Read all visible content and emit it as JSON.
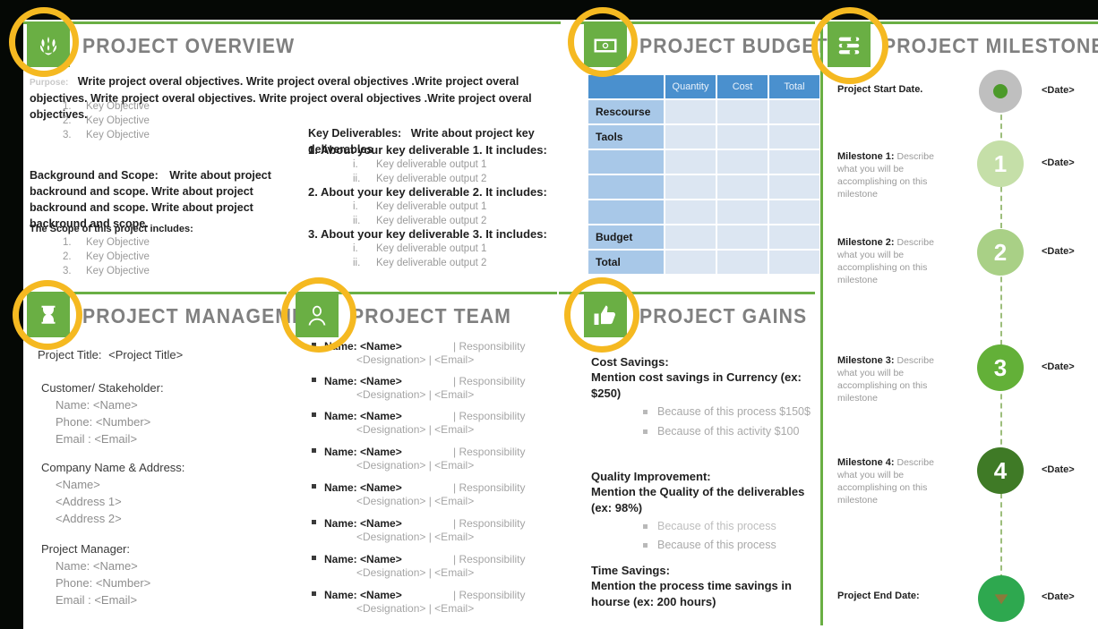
{
  "sections": {
    "overview": {
      "title": "PROJECT OVERVIEW",
      "icon": "laurel-wreath-icon",
      "purpose_label": "Purpose:",
      "purpose_text": "Write project overal objectives. Write project overal objectives .Write project overal objectives. Write project overal objectives. Write project overal objectives .Write project overal objectives.",
      "objectives": [
        "Key Objective",
        "Key Objective",
        "Key Objective"
      ],
      "background_label": "Background and Scope:",
      "background_text": "Write about project backround and scope. Write about project backround and scope. Write about project backround and scope.",
      "scope_label": "The Scope of this project includes:",
      "scope_items": [
        "Key Objective",
        "Key Objective",
        "Key Objective"
      ],
      "deliverables_label": "Key Deliverables:",
      "deliverables_text": "Write about project key deliverables",
      "deliverables": [
        {
          "heading": "1. About your key deliverable 1. It includes:",
          "outputs": [
            "Key deliverable output 1",
            "Key deliverable output 2"
          ]
        },
        {
          "heading": "2. About your key deliverable 2. It includes:",
          "outputs": [
            "Key deliverable output 1",
            "Key deliverable output 2"
          ]
        },
        {
          "heading": "3. About your key deliverable 3. It includes:",
          "outputs": [
            "Key deliverable output 1",
            "Key deliverable output 2"
          ]
        }
      ]
    },
    "budget": {
      "title": "PROJECT BUDGET",
      "icon": "money-bill-icon",
      "columns": [
        "",
        "Quantity",
        "Cost",
        "Total"
      ],
      "rows": [
        {
          "label": "Rescourse",
          "cells": [
            "",
            "",
            ""
          ]
        },
        {
          "label": "Taols",
          "cells": [
            "",
            "",
            ""
          ]
        },
        {
          "label": "",
          "cells": [
            "",
            "",
            ""
          ]
        },
        {
          "label": "",
          "cells": [
            "",
            "",
            ""
          ]
        },
        {
          "label": "",
          "cells": [
            "",
            "",
            ""
          ]
        },
        {
          "label": "Budget",
          "cells": [
            "",
            "",
            ""
          ]
        },
        {
          "label": "Total",
          "cells": [
            "",
            "",
            ""
          ]
        }
      ]
    },
    "milestones": {
      "title": "PROJECT MILESTONES",
      "icon": "sliders-icon",
      "items": [
        {
          "label": "Project Start Date.",
          "desc": "",
          "badge": "",
          "date": "<Date>",
          "color": "#BFBFBF",
          "dot": "#4C9A2A"
        },
        {
          "label": "Milestone 1:",
          "desc": " Describe what you will be accomplishing on this milestone",
          "badge": "1",
          "date": "<Date>",
          "color": "#C5DFA8",
          "dot": ""
        },
        {
          "label": "Milestone 2:",
          "desc": " Describe what you will be accomplishing on this milestone",
          "badge": "2",
          "date": "<Date>",
          "color": "#A9D086",
          "dot": ""
        },
        {
          "label": "Milestone 3:",
          "desc": " Describe what you will be accomplishing on this milestone",
          "badge": "3",
          "date": "<Date>",
          "color": "#63B038",
          "dot": ""
        },
        {
          "label": "Milestone 4:",
          "desc": " Describe what you will be accomplishing on this milestone",
          "badge": "4",
          "date": "<Date>",
          "color": "#3F7A26",
          "dot": ""
        },
        {
          "label": "Project End   Date:",
          "desc": "",
          "badge": "",
          "date": "<Date>",
          "color": "#2EA84F",
          "dot": "arrow-down-icon"
        }
      ]
    },
    "management": {
      "title": "PROJECT MANAGEMENT",
      "icon": "hourglass-icon",
      "project_title_label": "Project Title:",
      "project_title_value": "<Project Title>",
      "groups": [
        {
          "heading": "Customer/ Stakeholder:",
          "lines": [
            "Name: <Name>",
            "Phone: <Number>",
            "Email : <Email>"
          ]
        },
        {
          "heading": "Company Name &  Address:",
          "lines": [
            "<Name>",
            "<Address 1>",
            "<Address 2>"
          ]
        },
        {
          "heading": "Project Manager:",
          "lines": [
            "Name: <Name>",
            "Phone: <Number>",
            "Email : <Email>"
          ]
        }
      ]
    },
    "team": {
      "title": "PROJECT TEAM",
      "icon": "person-portrait-icon",
      "members": [
        {
          "name": "Name: <Name>",
          "responsibility": "| Responsibility",
          "detail": "<Designation> | <Email>"
        },
        {
          "name": "Name: <Name>",
          "responsibility": "| Responsibility",
          "detail": "<Designation> | <Email>"
        },
        {
          "name": "Name: <Name>",
          "responsibility": "| Responsibility",
          "detail": "<Designation> | <Email>"
        },
        {
          "name": "Name: <Name>",
          "responsibility": "| Responsibility",
          "detail": "<Designation> | <Email>"
        },
        {
          "name": "Name: <Name>",
          "responsibility": "| Responsibility",
          "detail": "<Designation> | <Email>"
        },
        {
          "name": "Name: <Name>",
          "responsibility": "| Responsibility",
          "detail": "<Designation> | <Email>"
        },
        {
          "name": "Name: <Name>",
          "responsibility": "| Responsibility",
          "detail": "<Designation> | <Email>"
        },
        {
          "name": "Name: <Name>",
          "responsibility": "| Responsibility",
          "detail": "<Designation> | <Email>"
        }
      ]
    },
    "gains": {
      "title": "PROJECT GAINS",
      "icon": "thumbs-up-icon",
      "groups": [
        {
          "heading": "Cost Savings:",
          "body": "Mention cost savings in Currency (ex: $250)",
          "bullets": [
            "Because of this process $150$",
            "Because of this activity  $100"
          ]
        },
        {
          "heading": "Quality Improvement:",
          "body": "Mention the Quality of the deliverables (ex: 98%)",
          "bullets": [
            "Because of this process",
            "Because of this process"
          ]
        },
        {
          "heading": "Time Savings:",
          "body": "Mention the process time savings in hourse (ex: 200 hours)",
          "bullets": []
        }
      ]
    }
  },
  "annotations": {
    "ring_color": "#F5B921",
    "rings": [
      "overview-icon-ring",
      "budget-icon-ring",
      "milestones-icon-ring",
      "management-icon-ring",
      "team-icon-ring",
      "gains-icon-ring"
    ]
  },
  "theme": {
    "green": "#6AAF44",
    "title_gray": "#808080",
    "table_header_blue": "#4A90CE",
    "table_label_blue": "#A8C8E8",
    "table_cell_blue": "#DCE6F2"
  }
}
